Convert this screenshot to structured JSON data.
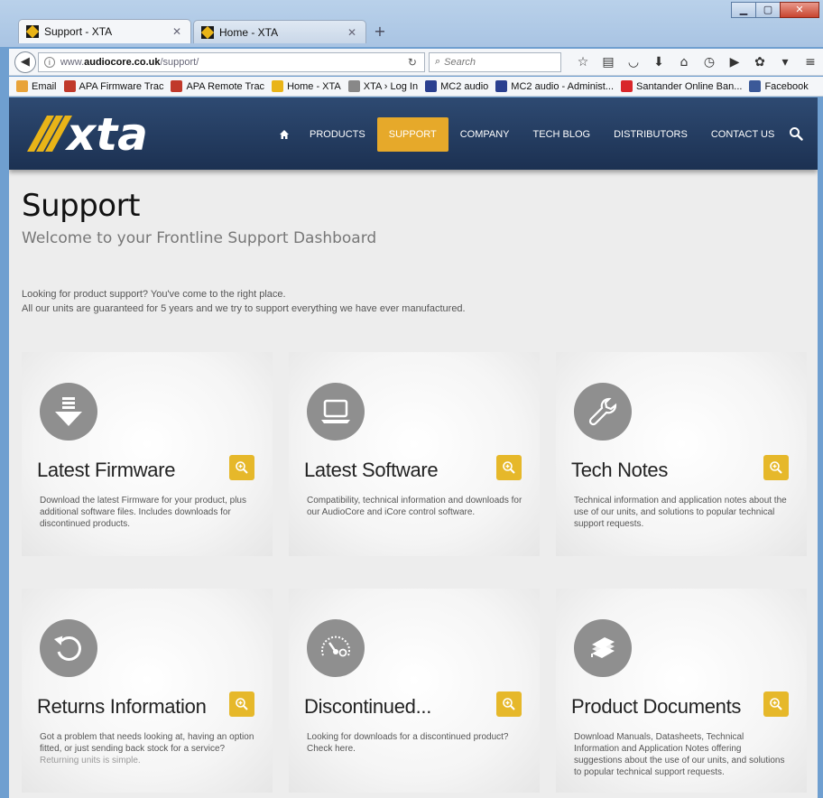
{
  "browser": {
    "tabs": [
      {
        "label": "Support - XTA",
        "active": true
      },
      {
        "label": "Home - XTA",
        "active": false
      }
    ],
    "url_prefix": "www.",
    "url_domain": "audiocore.co.uk",
    "url_path": "/support/",
    "search_placeholder": "Search",
    "bookmarks": [
      {
        "label": "Email",
        "color": "#e8a33a"
      },
      {
        "label": "APA Firmware Trac",
        "color": "#c0392b"
      },
      {
        "label": "APA Remote Trac",
        "color": "#c0392b"
      },
      {
        "label": "Home - XTA",
        "color": "#e9b418"
      },
      {
        "label": "XTA › Log In",
        "color": "#888888"
      },
      {
        "label": "MC2 audio",
        "color": "#2a3f8f"
      },
      {
        "label": "MC2 audio - Administ...",
        "color": "#2a3f8f"
      },
      {
        "label": "Santander Online Ban...",
        "color": "#d9262a"
      },
      {
        "label": "Facebook",
        "color": "#3b5998"
      }
    ]
  },
  "site": {
    "logo_text": "xta",
    "nav": [
      {
        "label": "PRODUCTS",
        "active": false
      },
      {
        "label": "SUPPORT",
        "active": true
      },
      {
        "label": "COMPANY",
        "active": false
      },
      {
        "label": "TECH BLOG",
        "active": false
      },
      {
        "label": "DISTRIBUTORS",
        "active": false
      },
      {
        "label": "CONTACT US",
        "active": false
      }
    ],
    "accent_color": "#e6a92a",
    "header_color": "#243c60"
  },
  "page": {
    "title": "Support",
    "subtitle": "Welcome to your Frontline Support Dashboard",
    "intro_line1": "Looking for product support? You've come to the right place.",
    "intro_line2": "All our units are guaranteed for 5 years and we try to support everything we have ever manufactured."
  },
  "cards": [
    {
      "title": "Latest Firmware",
      "icon": "download-icon",
      "desc": "Download the latest Firmware for your product, plus additional software files. Includes downloads for discontinued products.",
      "extra": ""
    },
    {
      "title": "Latest Software",
      "icon": "laptop-icon",
      "desc": "Compatibility, technical information and downloads for our AudioCore and iCore control software.",
      "extra": ""
    },
    {
      "title": "Tech Notes",
      "icon": "wrench-icon",
      "desc": "Technical information and application notes about the use of our units, and solutions to popular technical support requests.",
      "extra": ""
    },
    {
      "title": "Returns Information",
      "icon": "return-icon",
      "desc": "Got a problem that needs looking at, having an option fitted, or just sending back stock for a service?",
      "extra": "Returning units is simple."
    },
    {
      "title": "Discontinued...",
      "icon": "gauge-icon",
      "desc": "Looking for downloads for a discontinued product? Check here.",
      "extra": ""
    },
    {
      "title": "Product Documents",
      "icon": "books-icon",
      "desc": "Download Manuals, Datasheets, Technical Information and Application Notes offering suggestions about the use of our units, and solutions to popular technical support requests.",
      "extra": ""
    }
  ]
}
